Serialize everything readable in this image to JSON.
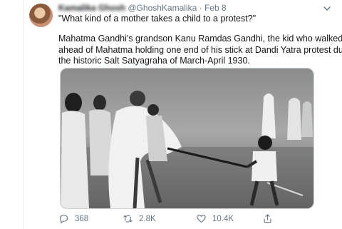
{
  "tweet": {
    "display_name": "Kamalika Ghosh",
    "handle": "@GhoshKamalika",
    "separator": "·",
    "date": "Feb 8",
    "quote": "\"What kind of a mother takes a child to a protest?\"",
    "body_lines": [
      "Mahatma Gandhi's grandson Kanu Ramdas Gandhi, the kid who walked",
      "ahead of Mahatma holding one end of his stick at Dandi Yatra protest during",
      "the historic Salt Satyagraha of March-April 1930."
    ],
    "image_icon": "photo-historical-black-white",
    "actions": {
      "reply_count": "368",
      "retweet_count": "2.8K",
      "like_count": "10.4K"
    },
    "icons": {
      "reply": "reply-icon",
      "retweet": "retweet-icon",
      "like": "heart-icon",
      "share": "share-icon",
      "menu": "chevron-down-icon"
    }
  },
  "colors": {
    "text_primary": "#14171a",
    "text_secondary": "#657786",
    "border": "#e6ecf0"
  }
}
